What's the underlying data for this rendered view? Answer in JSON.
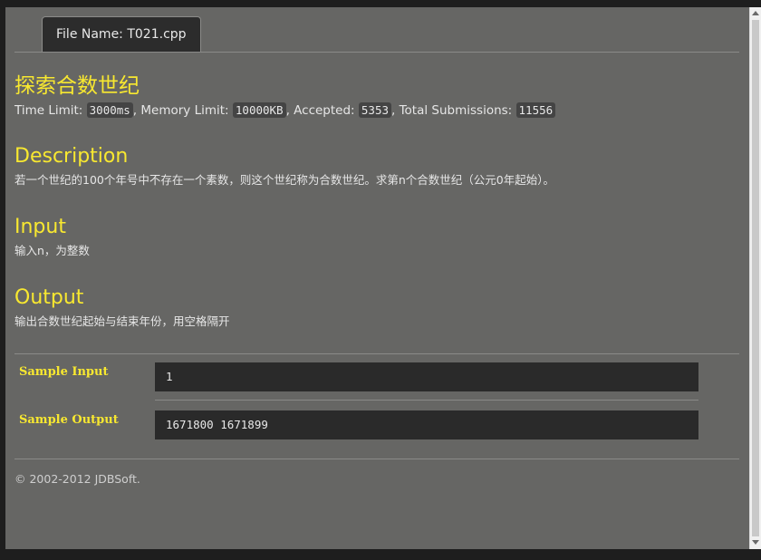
{
  "tab": {
    "file_label": "File Name:  T021.cpp"
  },
  "problem": {
    "title": "探索合数世纪",
    "limits": {
      "time_label": "Time Limit: ",
      "time_value": "3000ms",
      "memory_label": ", Memory Limit: ",
      "memory_value": "10000KB",
      "accepted_label": ", Accepted: ",
      "accepted_value": "5353",
      "submissions_label": ", Total Submissions: ",
      "submissions_value": "11556"
    },
    "description": {
      "heading": "Description",
      "text": "若一个世纪的100个年号中不存在一个素数，则这个世纪称为合数世纪。求第n个合数世纪（公元0年起始）。"
    },
    "input": {
      "heading": "Input",
      "text": "输入n，为整数"
    },
    "output": {
      "heading": "Output",
      "text": "输出合数世纪起始与结束年份，用空格隔开"
    },
    "sample_input": {
      "label": "Sample Input",
      "value": "1"
    },
    "sample_output": {
      "label": "Sample Output",
      "value": "1671800 1671899"
    }
  },
  "footer": {
    "text": "© 2002-2012  JDBSoft."
  },
  "colors": {
    "heading": "#f8e830",
    "background": "#666664",
    "code_box": "#2a2a2a"
  }
}
